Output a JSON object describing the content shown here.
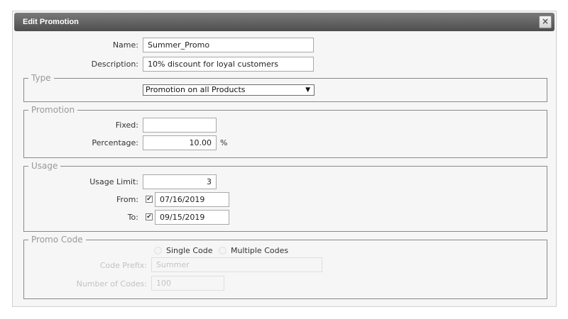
{
  "dialog": {
    "title": "Edit Promotion",
    "close_icon": "close-icon"
  },
  "form": {
    "name_label": "Name:",
    "name_value": "Summer_Promo",
    "description_label": "Description:",
    "description_value": "10% discount for loyal customers"
  },
  "type_group": {
    "legend": "Type",
    "selected": "Promotion on all Products",
    "arrow": "▼"
  },
  "promotion_group": {
    "legend": "Promotion",
    "fixed_label": "Fixed:",
    "fixed_value": "",
    "percentage_label": "Percentage:",
    "percentage_value": "10.00",
    "percentage_unit": "%"
  },
  "usage_group": {
    "legend": "Usage",
    "limit_label": "Usage Limit:",
    "limit_value": "3",
    "from_label": "From:",
    "from_checked": true,
    "from_value": "07/16/2019",
    "to_label": "To:",
    "to_checked": true,
    "to_value": "09/15/2019"
  },
  "promo_code_group": {
    "legend": "Promo Code",
    "single_code_label": "Single Code",
    "multiple_codes_label": "Multiple Codes",
    "code_prefix_label": "Code Prefix:",
    "code_prefix_placeholder": "Summer",
    "number_of_codes_label": "Number of Codes:",
    "number_of_codes_placeholder": "100"
  },
  "colors": {
    "titlebar": "#5e5e5e",
    "dialog_bg": "#f6f6f6",
    "border": "#8a8a8a"
  }
}
